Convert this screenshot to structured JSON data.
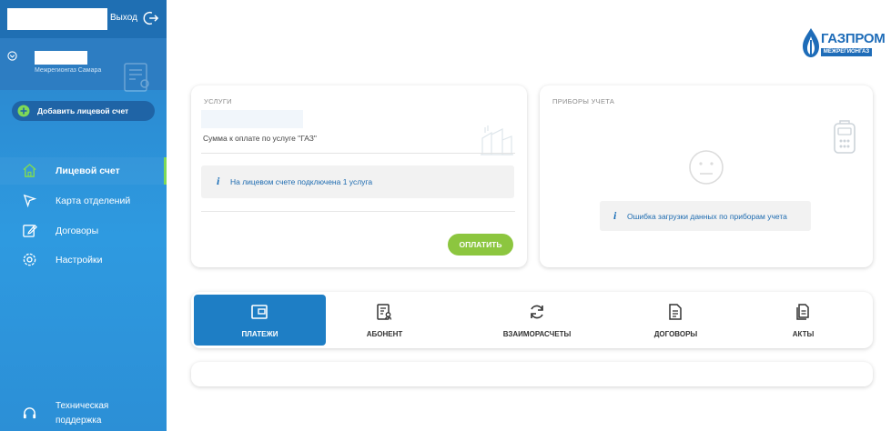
{
  "sidebar": {
    "logout_label": "Выход",
    "account_subtitle": "Межрегионгаз Самара",
    "add_account_label": "Добавить лицевой счет",
    "nav": [
      {
        "label": "Лицевой счет",
        "icon": "home-icon",
        "active": true
      },
      {
        "label": "Карта отделений",
        "icon": "map-pin-icon",
        "active": false
      },
      {
        "label": "Договоры",
        "icon": "edit-icon",
        "active": false
      },
      {
        "label": "Настройки",
        "icon": "gear-icon",
        "active": false
      }
    ],
    "support": {
      "line1": "Техническая",
      "line2": "поддержка"
    }
  },
  "logo": {
    "title": "ГАЗПРОМ",
    "subtitle": "МЕЖРЕГИОНГАЗ"
  },
  "services": {
    "title": "УСЛУГИ",
    "sum_label": "Сумма к оплате по услуге \"ГАЗ\"",
    "info": "На лицевом счете подключена 1 услуга",
    "pay_label": "ОПЛАТИТЬ"
  },
  "meters": {
    "title": "ПРИБОРЫ УЧЕТА",
    "error": "Ошибка загрузки данных по приборам учета"
  },
  "tabs": [
    {
      "label": "ПЛАТЕЖИ",
      "icon": "wallet-icon",
      "active": true
    },
    {
      "label": "АБОНЕНТ",
      "icon": "subscriber-doc-icon",
      "active": false
    },
    {
      "label": "ВЗАИМОРАСЧЕТЫ",
      "icon": "refresh-icon",
      "active": false
    },
    {
      "label": "ДОГОВОРЫ",
      "icon": "contract-doc-icon",
      "active": false
    },
    {
      "label": "АКТЫ",
      "icon": "acts-doc-icon",
      "active": false
    }
  ],
  "colors": {
    "sidebar": "#2a82c9",
    "accent_green": "#8cc63f",
    "active_tab": "#1e7ec5",
    "brand": "#1e6cb8"
  }
}
